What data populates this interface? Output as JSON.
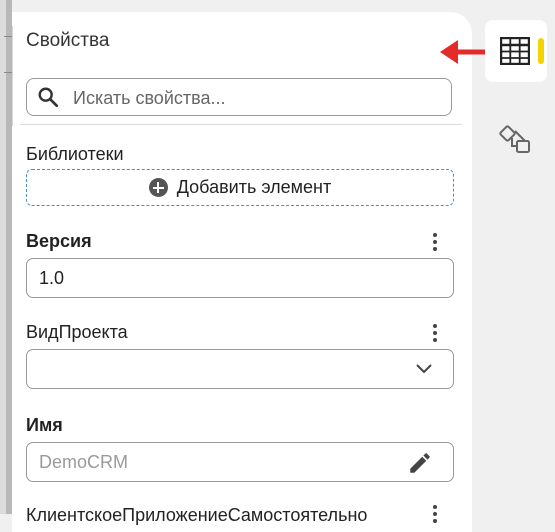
{
  "panel": {
    "title": "Свойства",
    "search": {
      "placeholder": "Искать свойства..."
    }
  },
  "libraries": {
    "label": "Библиотеки",
    "add_button_label": "Добавить элемент"
  },
  "fields": [
    {
      "label": "Версия",
      "bold": true,
      "value": "1.0",
      "control": "text"
    },
    {
      "label": "ВидПроекта",
      "bold": false,
      "value": "",
      "control": "select"
    },
    {
      "label": "Имя",
      "bold": true,
      "placeholder": "DemoCRM",
      "control": "text-edit"
    },
    {
      "label": "КлиентскоеПриложениеСамостоятельно",
      "bold": false,
      "control": "partial"
    }
  ],
  "right_rail": {
    "items": [
      {
        "icon": "table-icon",
        "active": true
      },
      {
        "icon": "diagram-icon",
        "active": false
      }
    ]
  },
  "colors": {
    "accent_yellow": "#f3d400",
    "arrow_red": "#e52a2a",
    "dashed_border_blue": "#4a8ec9"
  }
}
